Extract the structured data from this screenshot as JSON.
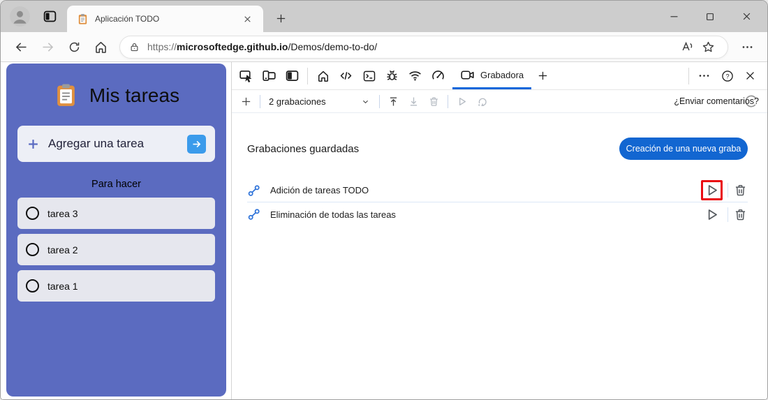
{
  "titlebar": {
    "tab_title": "Aplicación TODO"
  },
  "toolbar": {
    "url_scheme": "https://",
    "url_host": "microsoftedge.github.io",
    "url_path": "/Demos/demo-to-do/"
  },
  "todo_app": {
    "title": "Mis tareas",
    "add_task_label": "Agregar una tarea",
    "list_title": "Para hacer",
    "tasks": [
      "tarea 3",
      "tarea 2",
      "tarea 1"
    ]
  },
  "devtools": {
    "recorder_tab_label": "Grabadora",
    "recordings_count_label": "2 grabaciones",
    "feedback_label": "¿Enviar comentarios?",
    "saved_recordings_heading": "Grabaciones guardadas",
    "new_recording_button_label": "Creación de una nueva graba",
    "recordings": [
      {
        "name": "Adición de tareas TODO"
      },
      {
        "name": "Eliminación de todas las tareas"
      }
    ]
  },
  "colors": {
    "sidebar_purple": "#5b6bc0",
    "accent_blue": "#1266d1",
    "tab_underline_blue": "#0b66da",
    "highlight_red": "#ea0b12",
    "flow_icon_blue": "#2d72d9"
  }
}
